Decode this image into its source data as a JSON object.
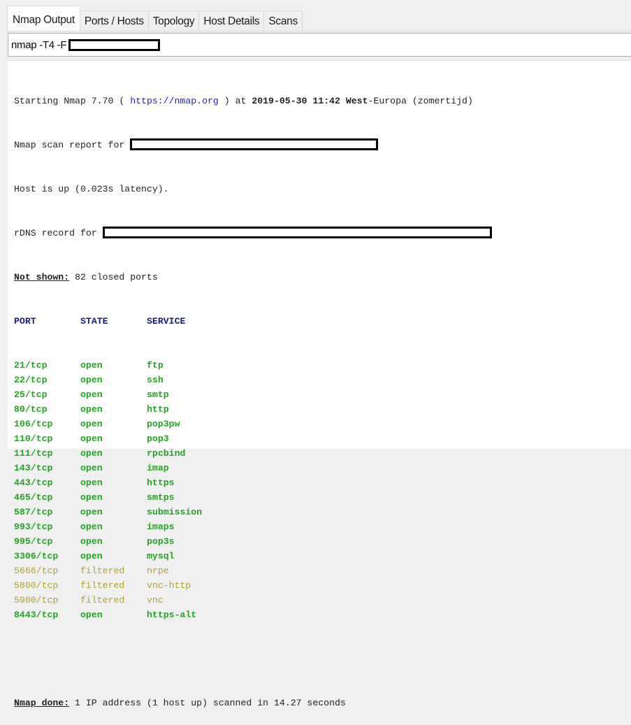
{
  "tabs": [
    {
      "label": "Nmap Output",
      "active": true
    },
    {
      "label": "Ports / Hosts",
      "active": false
    },
    {
      "label": "Topology",
      "active": false
    },
    {
      "label": "Host Details",
      "active": false
    },
    {
      "label": "Scans",
      "active": false
    }
  ],
  "command": {
    "value": "nmap -T4 -F",
    "redacted_target": true
  },
  "output": {
    "start_prefix": "Starting Nmap 7.70 ( ",
    "start_url": "https://nmap.org",
    "start_mid": " ) at ",
    "start_datetime": "2019-05-30 11:42",
    "start_tz_bold": " West",
    "start_tz_rest": "-Europa (zomertijd)",
    "report_prefix": "Nmap scan report for ",
    "host_up": "Host is up (0.023s latency).",
    "rdns_prefix": "rDNS record for ",
    "not_shown_label": "Not shown:",
    "not_shown_value": " 82 closed ports",
    "header": {
      "port": "PORT",
      "state": "STATE",
      "service": "SERVICE"
    },
    "ports": [
      {
        "port": "21/tcp",
        "state": "open",
        "service": "ftp"
      },
      {
        "port": "22/tcp",
        "state": "open",
        "service": "ssh"
      },
      {
        "port": "25/tcp",
        "state": "open",
        "service": "smtp"
      },
      {
        "port": "80/tcp",
        "state": "open",
        "service": "http"
      },
      {
        "port": "106/tcp",
        "state": "open",
        "service": "pop3pw"
      },
      {
        "port": "110/tcp",
        "state": "open",
        "service": "pop3"
      },
      {
        "port": "111/tcp",
        "state": "open",
        "service": "rpcbind"
      },
      {
        "port": "143/tcp",
        "state": "open",
        "service": "imap"
      },
      {
        "port": "443/tcp",
        "state": "open",
        "service": "https"
      },
      {
        "port": "465/tcp",
        "state": "open",
        "service": "smtps"
      },
      {
        "port": "587/tcp",
        "state": "open",
        "service": "submission"
      },
      {
        "port": "993/tcp",
        "state": "open",
        "service": "imaps"
      },
      {
        "port": "995/tcp",
        "state": "open",
        "service": "pop3s"
      },
      {
        "port": "3306/tcp",
        "state": "open",
        "service": "mysql"
      },
      {
        "port": "5666/tcp",
        "state": "filtered",
        "service": "nrpe"
      },
      {
        "port": "5800/tcp",
        "state": "filtered",
        "service": "vnc-http"
      },
      {
        "port": "5900/tcp",
        "state": "filtered",
        "service": "vnc"
      },
      {
        "port": "8443/tcp",
        "state": "open",
        "service": "https-alt"
      }
    ],
    "done_label": "Nmap done:",
    "done_value": " 1 IP address (1 host up) scanned in 14.27 seconds"
  },
  "colors": {
    "open": "#22a522",
    "filtered": "#b0a32a",
    "header": "#1c1c7e",
    "link": "#2020d0"
  }
}
